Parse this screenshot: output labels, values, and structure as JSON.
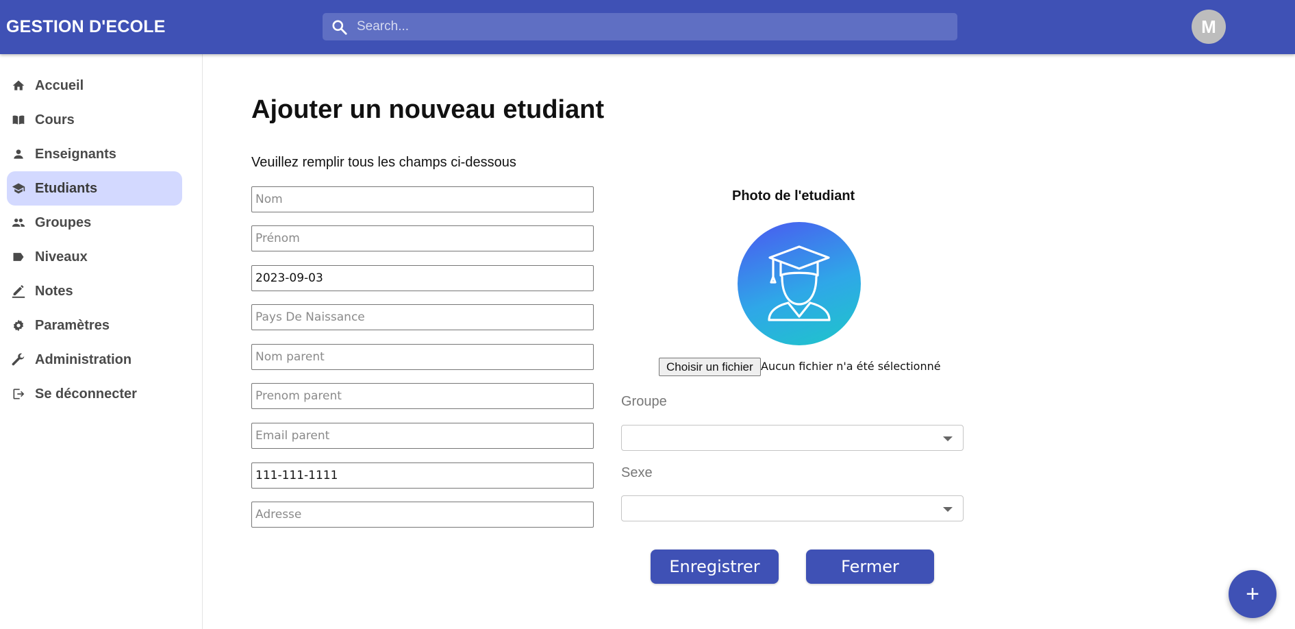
{
  "header": {
    "brand": "GESTION D'ECOLE",
    "search_placeholder": "Search...",
    "avatar_initial": "M"
  },
  "sidebar": {
    "items": [
      {
        "label": "Accueil",
        "icon": "home-icon"
      },
      {
        "label": "Cours",
        "icon": "book-icon"
      },
      {
        "label": "Enseignants",
        "icon": "person-icon"
      },
      {
        "label": "Etudiants",
        "icon": "school-icon",
        "active": true
      },
      {
        "label": "Groupes",
        "icon": "people-icon"
      },
      {
        "label": "Niveaux",
        "icon": "label-icon"
      },
      {
        "label": "Notes",
        "icon": "edit-icon"
      },
      {
        "label": "Paramètres",
        "icon": "gear-icon"
      },
      {
        "label": "Administration",
        "icon": "wrench-icon"
      },
      {
        "label": "Se déconnecter",
        "icon": "logout-icon"
      }
    ]
  },
  "form": {
    "title": "Ajouter un nouveau etudiant",
    "subtitle": "Veuillez remplir tous les champs ci-dessous",
    "fields": {
      "nom": {
        "placeholder": "Nom",
        "value": ""
      },
      "prenom": {
        "placeholder": "Prénom",
        "value": ""
      },
      "date_naissance": {
        "placeholder": "",
        "value": "2023-09-03"
      },
      "pays": {
        "placeholder": "Pays De Naissance",
        "value": ""
      },
      "nom_parent": {
        "placeholder": "Nom parent",
        "value": ""
      },
      "prenom_parent": {
        "placeholder": "Prenom parent",
        "value": ""
      },
      "email_parent": {
        "placeholder": "Email parent",
        "value": ""
      },
      "telephone": {
        "placeholder": "",
        "value": "111-111-1111"
      },
      "adresse": {
        "placeholder": "Adresse",
        "value": ""
      }
    },
    "photo": {
      "label": "Photo de l'etudiant",
      "icon": "student-graduate-icon",
      "file_button": "Choisir un fichier",
      "file_status": "Aucun fichier n'a été sélectionné"
    },
    "groupe_label": "Groupe",
    "groupe_value": "",
    "sexe_label": "Sexe",
    "sexe_value": "",
    "save_label": "Enregistrer",
    "close_label": "Fermer"
  },
  "fab_label": "+",
  "colors": {
    "primary": "#3f51b5",
    "active_nav": "#d3d9ff"
  }
}
